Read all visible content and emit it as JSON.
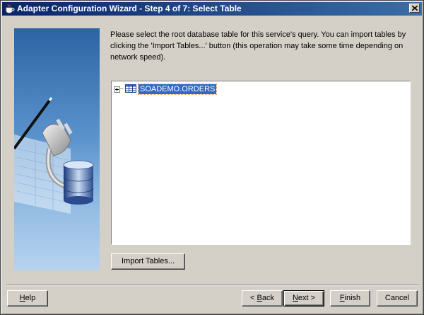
{
  "window": {
    "title": "Adapter Configuration Wizard - Step 4 of 7: Select Table"
  },
  "instructions": "Please select the root database table for this service's query.  You can import tables by clicking the 'Import Tables...' button (this operation may take some time depending on network speed).",
  "tree": {
    "nodes": [
      {
        "label": "SOADEMO.ORDERS",
        "icon": "table-icon",
        "selected": true,
        "expanded": false
      }
    ]
  },
  "buttons": {
    "import_tables": "Import Tables...",
    "help": {
      "accel": "H",
      "rest": "elp"
    },
    "back": {
      "prefix": "< ",
      "accel": "B",
      "rest": "ack"
    },
    "next": {
      "accel": "N",
      "rest": "ext >"
    },
    "finish": {
      "accel": "F",
      "rest": "inish"
    },
    "cancel": "Cancel"
  },
  "colors": {
    "titlebar_start": "#0a246a",
    "titlebar_end": "#3a6ea5",
    "selection": "#316ac5",
    "dialog_bg": "#d4d0c8"
  }
}
